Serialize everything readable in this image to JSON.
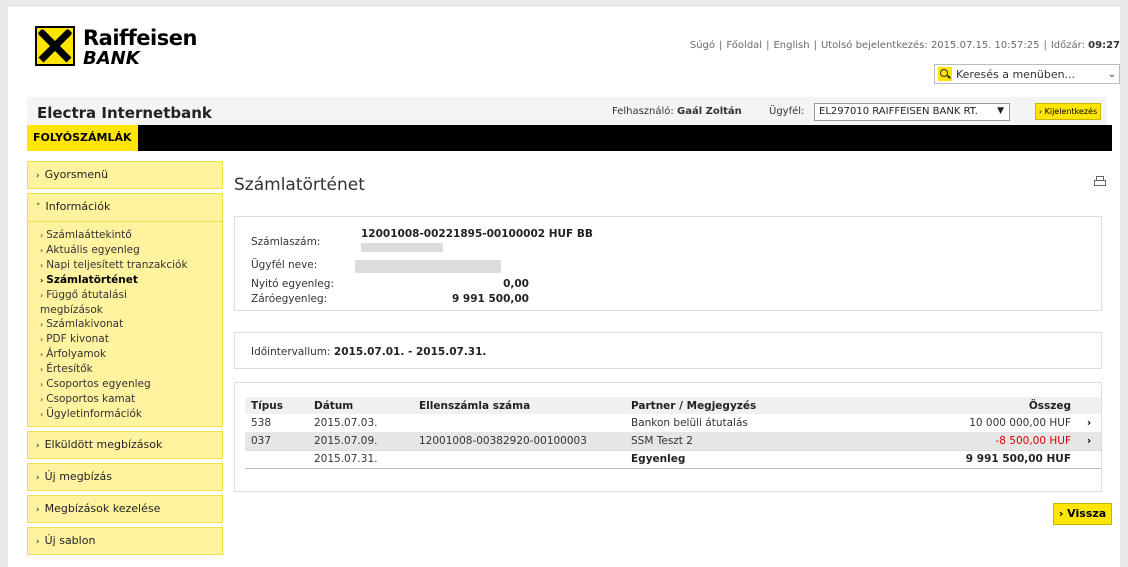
{
  "brand": {
    "name_line1": "Raiffeisen",
    "name_line2": "BANK"
  },
  "toplinks": {
    "help": "Súgó",
    "home": "Főoldal",
    "language": "English",
    "last_login": "Utolsó bejelentkezés: 2015.07.15. 10:57:25",
    "timer_label": "Időzár:",
    "timer_value": "09:27",
    "separator": "|"
  },
  "menu_search": {
    "placeholder": "Keresés a menüben...",
    "icon": "search-icon"
  },
  "app": {
    "title": "Electra Internetbank"
  },
  "user": {
    "label": "Felhasználó:",
    "name": "Gaál Zoltán"
  },
  "client": {
    "label": "Ügyfél:",
    "value": "EL297010 RAIFFEISEN BANK RT."
  },
  "logout": {
    "label": "› Kijelentkezés"
  },
  "nav": {
    "active_tab": "FOLYÓSZÁMLÁK"
  },
  "sidebar": {
    "groups": [
      {
        "label": "Gyorsmenü"
      },
      {
        "label": "Információk"
      },
      {
        "label": "Elküldött megbízások"
      },
      {
        "label": "Új megbízás"
      },
      {
        "label": "Megbízások kezelése"
      },
      {
        "label": "Új sablon"
      }
    ],
    "info_items": [
      "Számlaáttekintő",
      "Aktuális egyenleg",
      "Napi teljesített tranzakciók",
      "Számlatörténet",
      "Függő átutalási megbízások",
      "Számlakivonat",
      "PDF kivonat",
      "Árfolyamok",
      "Értesítők",
      "Csoportos egyenleg",
      "Csoportos kamat",
      "Ügyletinformációk"
    ]
  },
  "main": {
    "title": "Számlatörténet",
    "account": {
      "number_label": "Számlaszám:",
      "number_value": "12001008-00221895-00100002 HUF BB",
      "client_label": "Ügyfél neve:",
      "opening_label": "Nyitó egyenleg:",
      "opening_value": "0,00",
      "closing_label": "Záróegyenleg:",
      "closing_value": "9 991 500,00"
    },
    "interval": {
      "label": "Időintervallum:",
      "value": "2015.07.01. - 2015.07.31."
    },
    "table": {
      "headers": [
        "Típus",
        "Dátum",
        "Ellenszámla száma",
        "Partner / Megjegyzés",
        "Összeg"
      ],
      "rows": [
        {
          "type": "538",
          "date": "2015.07.03.",
          "counter": "",
          "partner": "Bankon belüli átutalás",
          "amount": "10 000 000,00 HUF"
        },
        {
          "type": "037",
          "date": "2015.07.09.",
          "counter": "12001008-00382920-00100003",
          "partner": "SSM Teszt 2",
          "amount": "-8 500,00 HUF"
        }
      ],
      "total": {
        "date": "2015.07.31.",
        "label": "Egyenleg",
        "amount": "9 991 500,00 HUF"
      }
    },
    "back_button": "› Vissza"
  }
}
